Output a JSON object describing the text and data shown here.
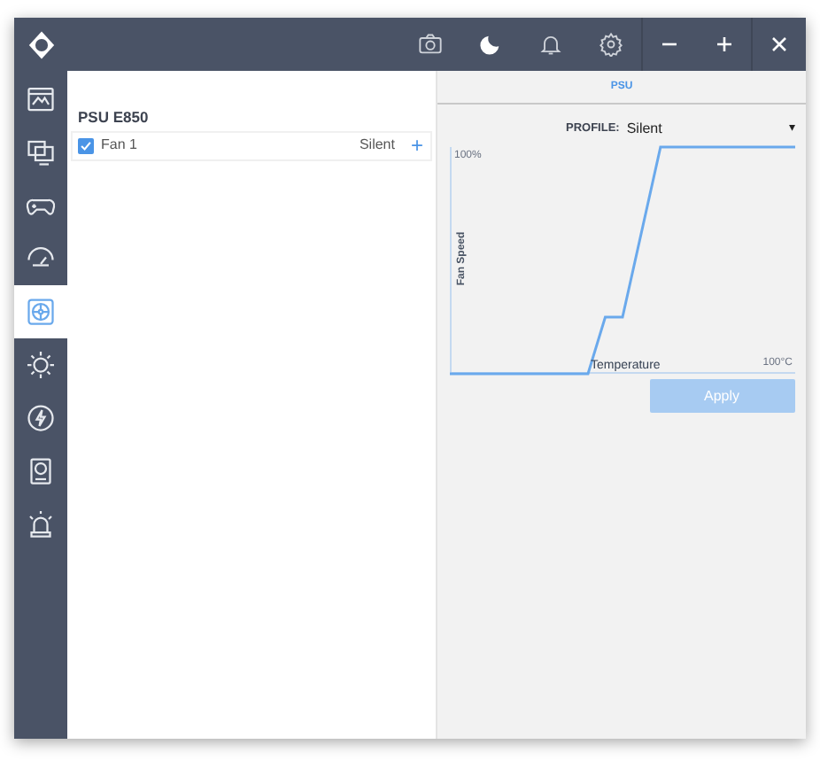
{
  "sidebar": {
    "items": [
      {
        "kind": "monitor",
        "selected": false
      },
      {
        "kind": "desktop",
        "selected": false
      },
      {
        "kind": "gamepad",
        "selected": false
      },
      {
        "kind": "gauge",
        "selected": false
      },
      {
        "kind": "fan",
        "selected": true
      },
      {
        "kind": "sun",
        "selected": false
      },
      {
        "kind": "bolt",
        "selected": false
      },
      {
        "kind": "drive",
        "selected": false
      },
      {
        "kind": "alarm",
        "selected": false
      }
    ]
  },
  "device": {
    "title": "PSU E850",
    "fans": [
      {
        "name": "Fan 1",
        "checked": true,
        "profile": "Silent",
        "add": "+"
      }
    ]
  },
  "tabs": [
    {
      "label": "PSU",
      "selected": true
    }
  ],
  "profile": {
    "label": "PROFILE:",
    "value": "Silent",
    "arrow": "▾"
  },
  "chart": {
    "xlabel": "Temperature",
    "ylabel": "Fan Speed",
    "y_max_label": "100%",
    "x_max_label": "100°C"
  },
  "apply": {
    "label": "Apply",
    "disabled": true
  }
}
